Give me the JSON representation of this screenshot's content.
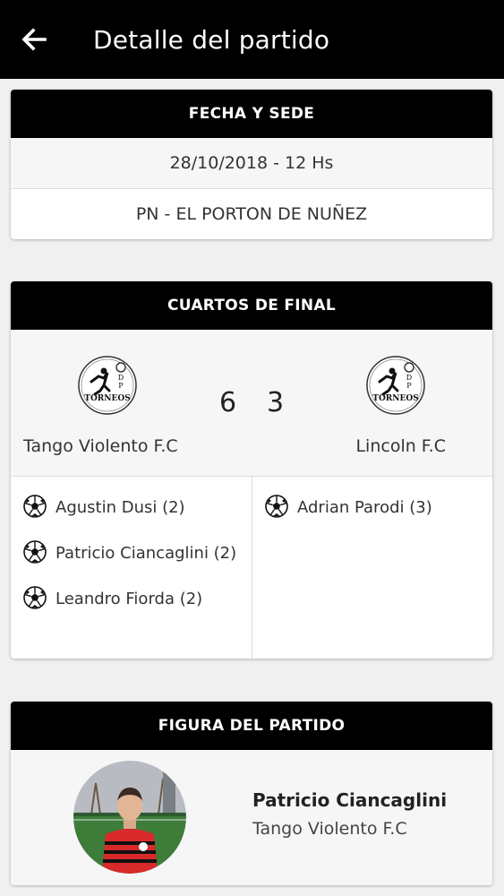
{
  "header": {
    "title": "Detalle del partido",
    "back_icon": "arrow-left-icon"
  },
  "fecha_sede": {
    "title": "FECHA Y SEDE",
    "date_time": "28/10/2018 - 12 Hs",
    "venue": "PN - EL PORTON DE NUÑEZ"
  },
  "match": {
    "round": "CUARTOS DE FINAL",
    "home": {
      "name": "Tango Violento F.C",
      "score": "6"
    },
    "away": {
      "name": "Lincoln F.C",
      "score": "3"
    },
    "home_scorers": [
      "Agustin Dusi (2)",
      "Patricio Ciancaglini (2)",
      "Leandro Fiorda (2)"
    ],
    "away_scorers": [
      "Adrian Parodi (3)"
    ]
  },
  "figura": {
    "title": "FIGURA DEL PARTIDO",
    "player": "Patricio Ciancaglini",
    "team": "Tango Violento F.C"
  },
  "colors": {
    "header_bg": "#000000",
    "card_bg": "#ffffff",
    "row_alt_bg": "#f6f6f6"
  }
}
